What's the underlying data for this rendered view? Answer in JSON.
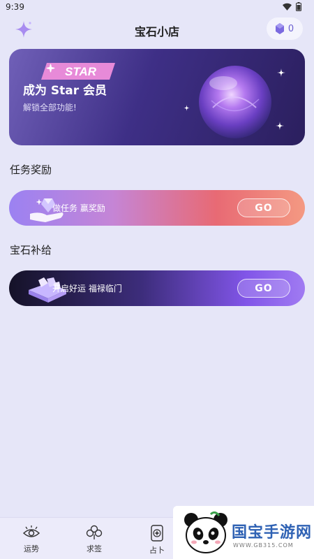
{
  "status_bar": {
    "time": "9:39"
  },
  "header": {
    "title": "宝石小店",
    "gem_count": "0"
  },
  "star_card": {
    "badge": "STAR",
    "title": "成为 Star 会员",
    "subtitle": "解锁全部功能!"
  },
  "sections": {
    "task": "任务奖励",
    "supply": "宝石补给"
  },
  "task_card": {
    "text": "做任务 赢奖励",
    "button": "GO"
  },
  "supply_card": {
    "text": "开启好运 福禄临门",
    "button": "GO"
  },
  "nav": [
    {
      "label": "运势",
      "icon": "eye-icon"
    },
    {
      "label": "求签",
      "icon": "clover-icon"
    },
    {
      "label": "占卜",
      "icon": "tarot-card-icon"
    }
  ],
  "watermark": {
    "brand": "国宝手游网",
    "url": "WWW.GB315.COM"
  },
  "colors": {
    "accent": "#6a5fd0",
    "background": "#e6e6f8"
  }
}
